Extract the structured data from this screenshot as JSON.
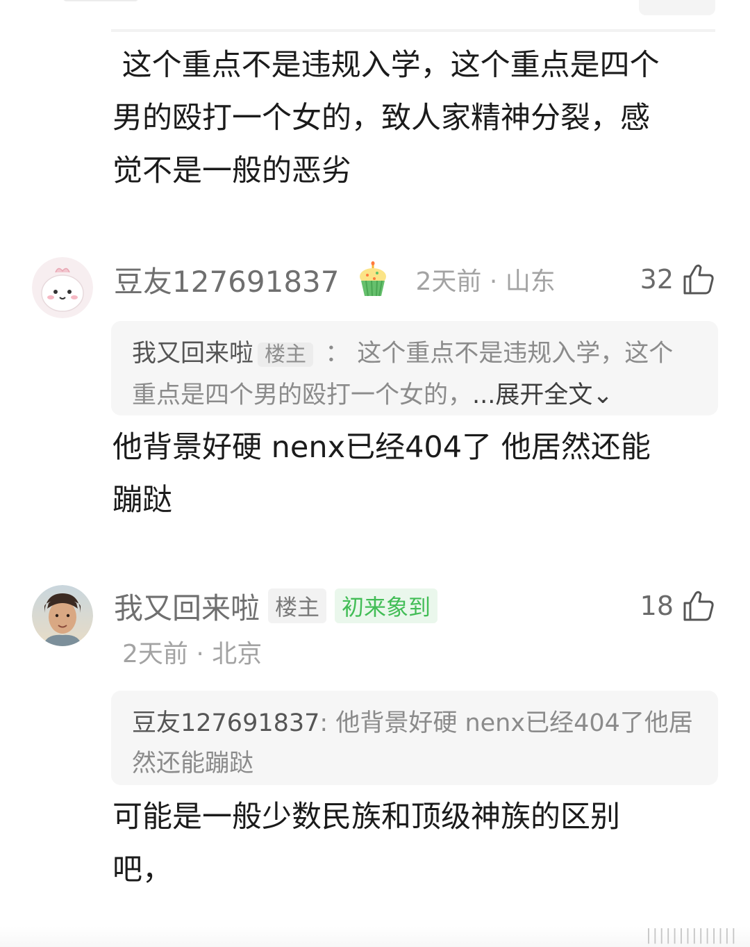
{
  "top_comment": {
    "text": " 这个重点不是违规入学，这个重点是四个\n男的殴打一个女的，致人家精神分裂，感\n觉不是一般的恶劣"
  },
  "comment1": {
    "username": "豆友127691837",
    "badge_icon": "cupcake-icon",
    "time_location": "2天前 · 山东",
    "likes": "32",
    "quote": {
      "author": "我又回来啦",
      "author_tag": "楼主",
      "separator": " ： ",
      "text": "这个重点不是违规入学，这个重点是四个男的殴打一个女的，",
      "expand": "...展开全文⌄"
    },
    "text": "他背景好硬 nenx已经404了 他居然还能\n蹦跶"
  },
  "comment2": {
    "username": "我又回来啦",
    "tag_op": "楼主",
    "tag_newcomer": "初来象到",
    "time_location": "2天前 · 北京",
    "likes": "18",
    "quote": {
      "author": "豆友127691837",
      "separator": ": ",
      "text": "他背景好硬 nenx已经404了他居然还能蹦跶"
    },
    "text": "可能是一般少数民族和顶级神族的区别\n吧，"
  },
  "colors": {
    "accent_green": "#42bd56",
    "quote_bg": "#f6f6f6",
    "meta_gray": "#a3a3a3"
  }
}
